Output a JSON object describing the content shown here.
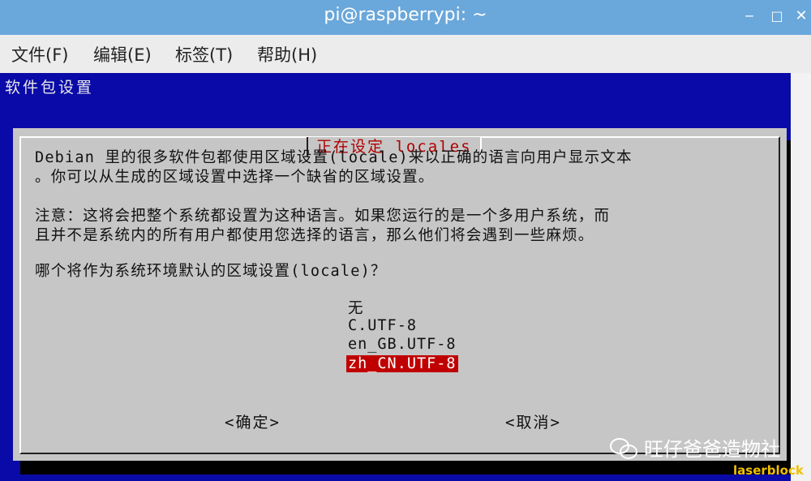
{
  "window": {
    "title": "pi@raspberrypi: ~"
  },
  "menu": [
    "文件(F)",
    "编辑(E)",
    "标签(T)",
    "帮助(H)"
  ],
  "background_title": "软件包设置",
  "dialog": {
    "title": "正在设定 locales",
    "lines": [
      "Debian 里的很多软件包都使用区域设置(locale)来以正确的语言向用户显示文本",
      "。你可以从生成的区域设置中选择一个缺省的区域设置。",
      "注意：这将会把整个系统都设置为这种语言。如果您运行的是一个多用户系统，而",
      "且并不是系统内的所有用户都使用您选择的语言，那么他们将会遇到一些麻烦。",
      "哪个将作为系统环境默认的区域设置(locale)？"
    ],
    "options": [
      "无",
      "C.UTF-8",
      "en_GB.UTF-8",
      "zh_CN.UTF-8"
    ],
    "selected_option": "zh_CN.UTF-8",
    "ok_label": "<确定>",
    "cancel_label": "<取消>"
  },
  "watermark": {
    "text": "旺仔爸爸造物社",
    "tag": "laserblock"
  },
  "colors": {
    "titlebar": "#6aa7da",
    "terminal_bg": "#0a0aa8",
    "dialog_bg": "#c6c6c6",
    "selected": "#c00000"
  }
}
